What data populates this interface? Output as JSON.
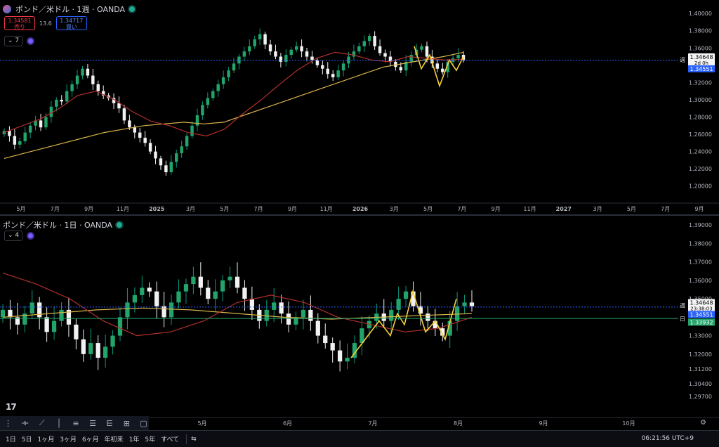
{
  "top": {
    "title": "ポンド／米ドル · 1週 · OANDA",
    "sell_price": "1.34581",
    "sell_label": "売り",
    "spread": "13.6",
    "buy_price": "1.34717",
    "buy_label": "買い",
    "indicator_count": "7",
    "price_labels": [
      "1.40000",
      "1.38000",
      "1.36000",
      "1.32000",
      "1.30000",
      "1.28000",
      "1.26000",
      "1.24000",
      "1.22000",
      "1.20000"
    ],
    "date_labels": [
      "5月",
      "7月",
      "9月",
      "11月",
      "2025",
      "3月",
      "5月",
      "7月",
      "9月",
      "11月",
      "2026",
      "3月",
      "5月",
      "7月",
      "9月",
      "11月",
      "2027",
      "3月",
      "5月",
      "7月",
      "9月"
    ],
    "current_price": "1.34648",
    "countdown": "2d 0h",
    "line_price": "1.34551",
    "week_tag": "週"
  },
  "bottom": {
    "title": "ポンド／米ドル · 1日 · OANDA",
    "indicator_count": "4",
    "price_labels": [
      "1.39000",
      "1.38000",
      "1.37000",
      "1.36000",
      "1.35000",
      "1.33000",
      "1.32000",
      "1.31200",
      "1.30400",
      "1.29700"
    ],
    "date_labels": [
      "5月",
      "6月",
      "7月",
      "8月",
      "9月",
      "10月"
    ],
    "current_price": "1.34648",
    "countdown": "23:38:03",
    "line_price_w": "1.34551",
    "line_price_d": "1.33932",
    "week_tag": "週",
    "day_tag": "日"
  },
  "bottombar": {
    "timeframes": [
      "1日",
      "5日",
      "1ヶ月",
      "3ヶ月",
      "6ヶ月",
      "年初来",
      "1年",
      "5年",
      "すべて"
    ],
    "clock": "06:21:56 UTC+9"
  },
  "chart_data": [
    {
      "type": "candlestick",
      "title": "ポンド／米ドル · 1週 · OANDA",
      "ylim": [
        1.19,
        1.405
      ],
      "x_ticks": [
        "5月",
        "7月",
        "9月",
        "11月",
        "2025",
        "3月",
        "5月",
        "7月",
        "9月",
        "11月",
        "2026",
        "3月",
        "5月",
        "7月",
        "9月",
        "11月",
        "2027",
        "3月",
        "5月",
        "7月",
        "9月"
      ],
      "close_series": [
        1.264,
        1.258,
        1.248,
        1.252,
        1.262,
        1.27,
        1.276,
        1.268,
        1.28,
        1.292,
        1.3,
        1.298,
        1.31,
        1.318,
        1.328,
        1.336,
        1.328,
        1.318,
        1.31,
        1.305,
        1.302,
        1.296,
        1.29,
        1.276,
        1.268,
        1.262,
        1.256,
        1.25,
        1.24,
        1.232,
        1.224,
        1.216,
        1.228,
        1.238,
        1.246,
        1.258,
        1.27,
        1.282,
        1.294,
        1.302,
        1.31,
        1.318,
        1.326,
        1.334,
        1.342,
        1.35,
        1.356,
        1.362,
        1.37,
        1.376,
        1.364,
        1.356,
        1.35,
        1.344,
        1.352,
        1.358,
        1.362,
        1.356,
        1.35,
        1.346,
        1.34,
        1.336,
        1.33,
        1.326,
        1.334,
        1.342,
        1.35,
        1.356,
        1.362,
        1.368,
        1.374,
        1.362,
        1.354,
        1.35,
        1.344,
        1.338,
        1.334,
        1.344,
        1.352,
        1.358,
        1.362,
        1.35,
        1.342,
        1.336,
        1.332,
        1.344,
        1.348,
        1.352,
        1.346
      ],
      "ma_slow": [
        1.232,
        1.238,
        1.244,
        1.25,
        1.256,
        1.262,
        1.266,
        1.27,
        1.272,
        1.274,
        1.272,
        1.274,
        1.282,
        1.29,
        1.298,
        1.306,
        1.314,
        1.322,
        1.33,
        1.338,
        1.342,
        1.346,
        1.35,
        1.355
      ],
      "ma_fast": [
        1.262,
        1.27,
        1.278,
        1.29,
        1.305,
        1.31,
        1.3,
        1.286,
        1.275,
        1.27,
        1.262,
        1.258,
        1.266,
        1.284,
        1.3,
        1.318,
        1.335,
        1.348,
        1.355,
        1.352,
        1.346,
        1.344,
        1.35,
        1.348,
        1.346,
        1.347
      ],
      "current_price": 1.34648,
      "line_price": 1.34551
    },
    {
      "type": "candlestick",
      "title": "ポンド／米ドル · 1日 · OANDA",
      "ylim": [
        1.294,
        1.392
      ],
      "x_ticks": [
        "5月",
        "6月",
        "7月",
        "8月",
        "9月",
        "10月"
      ],
      "close_series": [
        1.344,
        1.34,
        1.336,
        1.342,
        1.348,
        1.34,
        1.332,
        1.338,
        1.344,
        1.336,
        1.328,
        1.32,
        1.326,
        1.318,
        1.324,
        1.33,
        1.34,
        1.348,
        1.352,
        1.356,
        1.354,
        1.346,
        1.34,
        1.348,
        1.354,
        1.358,
        1.362,
        1.356,
        1.35,
        1.354,
        1.36,
        1.362,
        1.356,
        1.35,
        1.344,
        1.338,
        1.344,
        1.348,
        1.342,
        1.336,
        1.34,
        1.344,
        1.338,
        1.33,
        1.326,
        1.322,
        1.316,
        1.318,
        1.326,
        1.334,
        1.338,
        1.342,
        1.338,
        1.344,
        1.35,
        1.354,
        1.346,
        1.342,
        1.338,
        1.334,
        1.33,
        1.338,
        1.346,
        1.348,
        1.346
      ],
      "ma_slow": [
        1.34,
        1.342,
        1.344,
        1.345,
        1.344,
        1.342,
        1.34,
        1.339,
        1.34,
        1.341,
        1.342
      ],
      "ma_fast": [
        1.364,
        1.358,
        1.35,
        1.338,
        1.33,
        1.332,
        1.338,
        1.348,
        1.352,
        1.348,
        1.34,
        1.336,
        1.332,
        1.334,
        1.34
      ],
      "current_price": 1.34648,
      "line_price": 1.34551,
      "secondary_line_price": 1.33932
    }
  ]
}
